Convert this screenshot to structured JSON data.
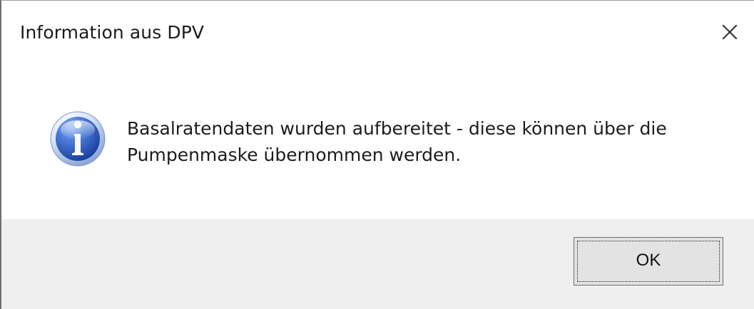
{
  "dialog": {
    "title": "Information aus DPV",
    "close_icon": "close-icon",
    "message_icon": "info-icon",
    "message_lines": [
      "Basalratendaten wurden aufbereitet - diese können über die",
      "Pumpenmaske übernommen werden."
    ],
    "ok_label": "OK"
  },
  "colors": {
    "content_background": "#ffffff",
    "footer_background": "#efefef",
    "button_background": "#e3e3e3",
    "button_border": "#6f6f6f",
    "text": "#1c1c1c",
    "icon_blue": "#1f57bd"
  }
}
